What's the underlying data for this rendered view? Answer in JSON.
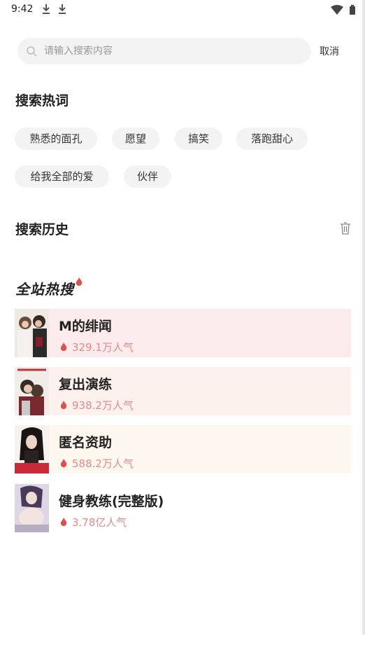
{
  "status_bar": {
    "time": "9:42"
  },
  "search": {
    "placeholder": "请输入搜索内容",
    "cancel_label": "取消"
  },
  "hot_words": {
    "title": "搜索热词",
    "tags": [
      "熟悉的面孔",
      "愿望",
      "搞笑",
      "落跑甜心",
      "给我全部的爱",
      "伙伴"
    ]
  },
  "history": {
    "title": "搜索历史"
  },
  "site_hot": {
    "title": "全站热搜",
    "items": [
      {
        "title": "M的绯闻",
        "heat": "329.1万人气",
        "bg": "#fcebec"
      },
      {
        "title": "复出演练",
        "heat": "938.2万人气",
        "bg": "#fdf1ee"
      },
      {
        "title": "匿名资助",
        "heat": "588.2万人气",
        "bg": "#fef7ef"
      },
      {
        "title": "健身教练(完整版)",
        "heat": "3.78亿人气",
        "bg": "#ffffff"
      }
    ]
  },
  "colors": {
    "accent": "#e0504a",
    "heat_text": "#e08a8a"
  }
}
